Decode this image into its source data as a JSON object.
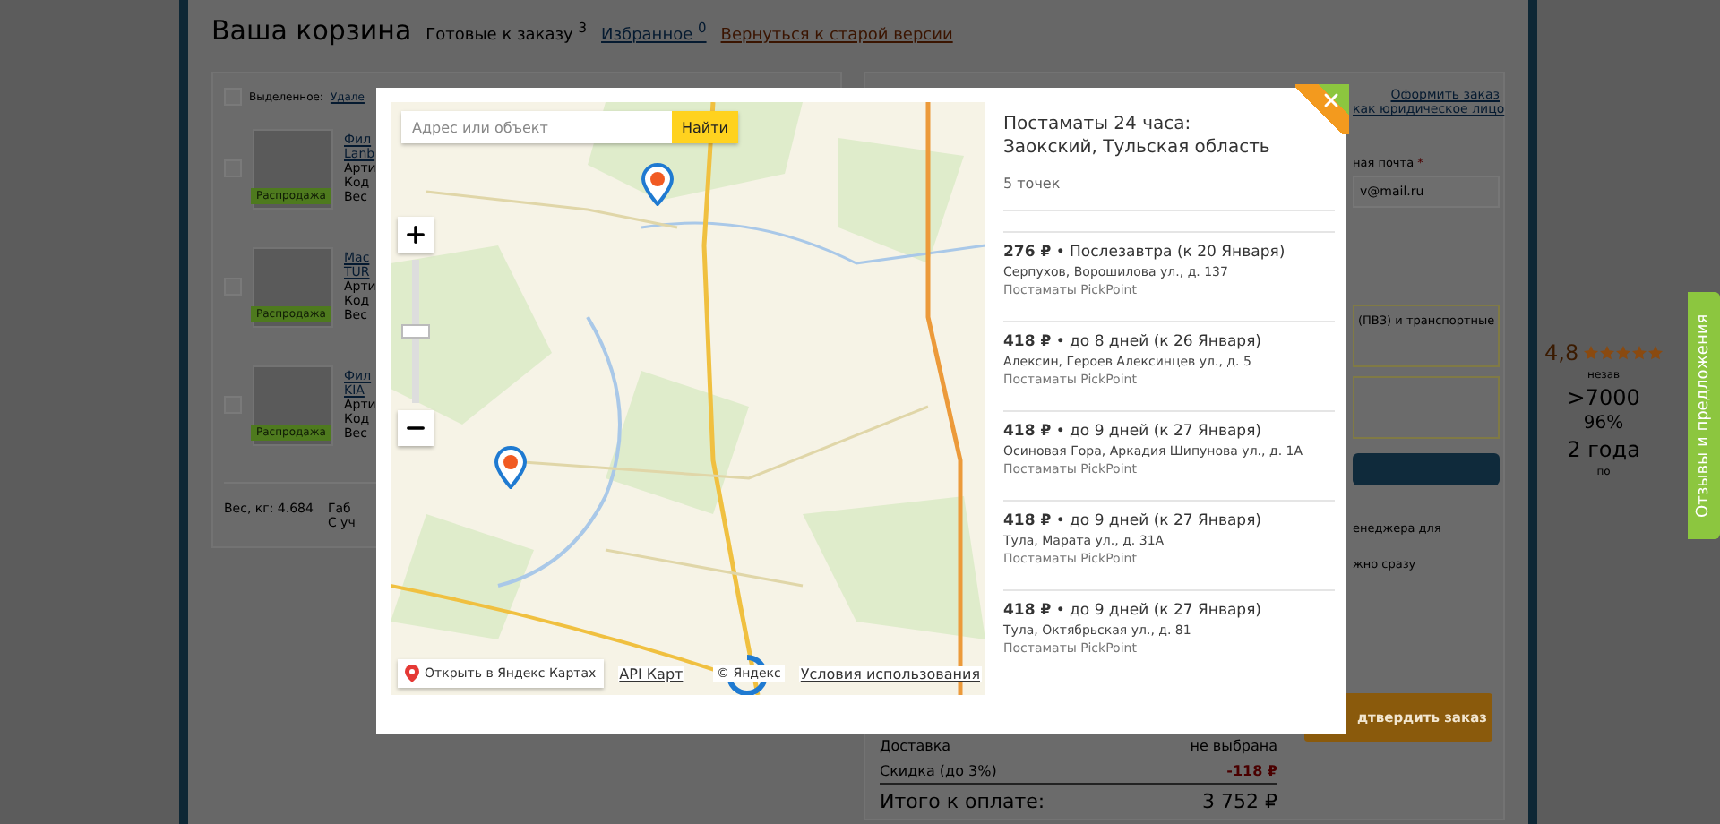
{
  "header": {
    "title": "Ваша корзина",
    "tabs": [
      {
        "label": "Готовые к заказу $^{3}$",
        "selected": true
      },
      {
        "label": "Избранное $^{0}$",
        "selected": false
      }
    ],
    "old_version_link": "Вернуться к старой версии"
  },
  "cart": {
    "selection_label": "Выделенное:",
    "selection_checked": false,
    "delete_link": "Удале",
    "items": [
      {
        "checked": false,
        "name_lines": [
          "Фил",
          "Lanb"
        ],
        "meta": [
          "Арти",
          "Код",
          "Вес"
        ],
        "badge": "Распродажа"
      },
      {
        "checked": false,
        "name_lines": [
          "Мас",
          "TUR"
        ],
        "meta": [
          "Арти",
          "Код",
          "Вес"
        ],
        "badge": "Распродажа"
      },
      {
        "checked": false,
        "name_lines": [
          "Фил",
          "KIA"
        ],
        "meta": [
          "Арти",
          "Код",
          "Вес"
        ],
        "badge": "Распродажа"
      }
    ],
    "weight": "Вес, кг: 4.684",
    "dims": [
      "Габ",
      "С уч"
    ]
  },
  "order": {
    "legal_link": [
      "Оформить заказ",
      "как юридическое лицо"
    ],
    "email_label": "ная почта",
    "required_mark": "*",
    "email_value": "v@mail.ru",
    "delivery_note": "(ПВЗ) и транспортные",
    "manager_note": "енеджера для",
    "note_2": "жно сразу",
    "confirm_button": "дтвердить заказ",
    "summary": [
      {
        "label": "Доставка",
        "value": "не выбрана",
        "kind": "plain"
      },
      {
        "label": "Скидка (до 3%)",
        "value": "-118 ₽",
        "kind": "discount"
      },
      {
        "label": "Итого к оплате:",
        "value": "3 752 ₽",
        "kind": "total"
      }
    ]
  },
  "rating": {
    "score": "4,8",
    "stars": 5,
    "reviews": ">7000",
    "percent": "96%",
    "years": "2 года",
    "side_1": "незав",
    "side_2": "по"
  },
  "feedback_tab": "Отзывы и предложения",
  "modal": {
    "search": {
      "placeholder": "Адрес или объект",
      "button": "Найти"
    },
    "zoom": {
      "level": 0.5
    },
    "map_links": {
      "open": "Открыть в Яндекс Картах",
      "api": "API Карт",
      "copyright": "© Яндекс",
      "terms": "Условия использования"
    },
    "title_lines": [
      "Постаматы 24 часа:",
      "Заокский, Тульская область"
    ],
    "count": "5 точек",
    "points": [
      {
        "headline": "**276 ₽** • Послезавтра (к 20 Января)",
        "address": "Серпухов, Ворошилова ул., д. 137",
        "provider": "Постаматы PickPoint"
      },
      {
        "headline": "**418 ₽** • до 8 дней (к 26 Января)",
        "address": "Алексин, Героев Алексинцев ул., д. 5",
        "provider": "Постаматы PickPoint"
      },
      {
        "headline": "**418 ₽** • до 9 дней (к 27 Января)",
        "address": "Осиновая Гора, Аркадия Шипунова ул., д. 1А",
        "provider": "Постаматы PickPoint"
      },
      {
        "headline": "**418 ₽** • до 9 дней (к 27 Января)",
        "address": "Тула, Марата ул., д. 31А",
        "provider": "Постаматы PickPoint"
      },
      {
        "headline": "**418 ₽** • до 9 дней (к 27 Января)",
        "address": "Тула, Октябрьская ул., д. 81",
        "provider": "Постаматы PickPoint"
      }
    ]
  }
}
